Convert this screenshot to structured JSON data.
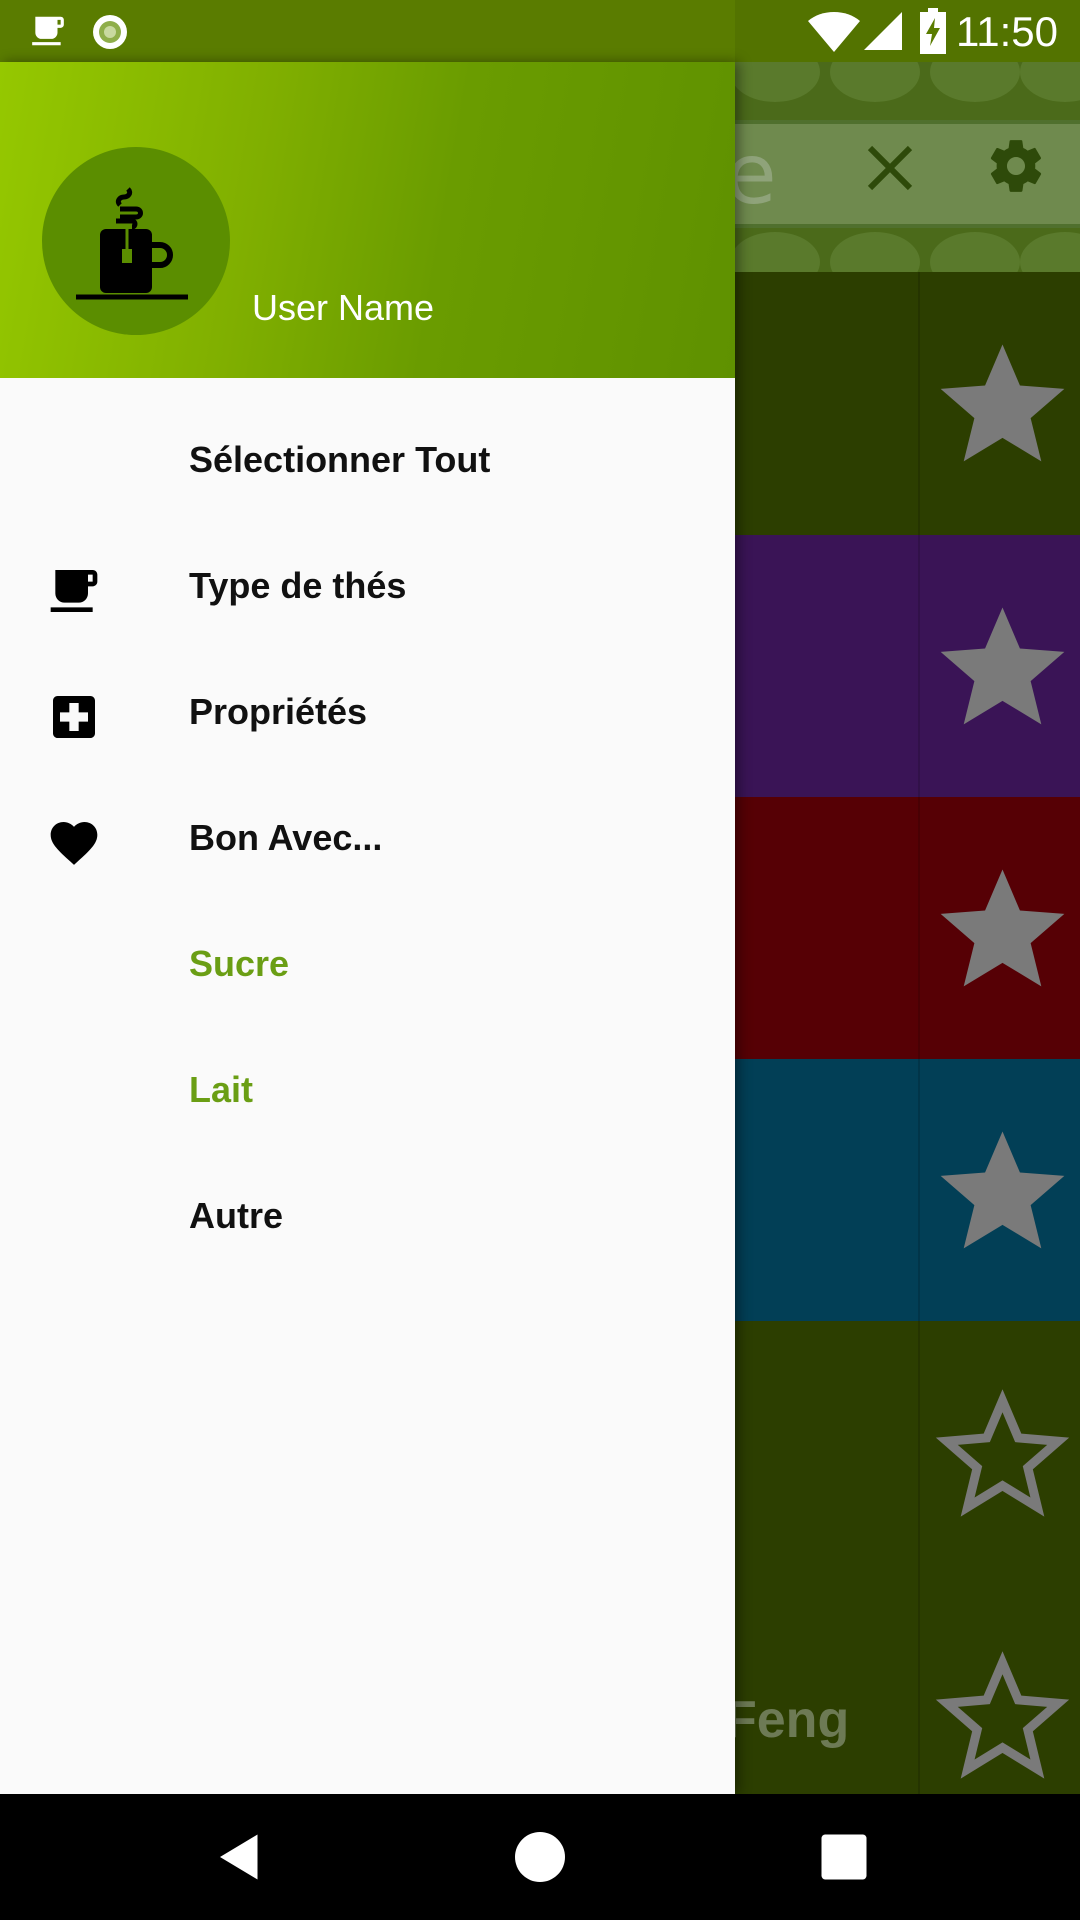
{
  "status_bar": {
    "time": "11:50",
    "icons": [
      "coffee-notification-icon",
      "sync-circle-icon",
      "wifi-icon",
      "signal-icon",
      "battery-charging-icon"
    ]
  },
  "drawer": {
    "header": {
      "user_name": "User Name",
      "avatar_icon": "tea-mug-icon",
      "gradient_start": "#95c800",
      "gradient_end": "#5f9100"
    },
    "items": [
      {
        "label": "Sélectionner Tout",
        "icon": null,
        "color": "#111111"
      },
      {
        "label": "Type de thés",
        "icon": "coffee-cup-icon",
        "color": "#111111"
      },
      {
        "label": "Propriétés",
        "icon": "medical-plus-icon",
        "color": "#111111"
      },
      {
        "label": "Bon Avec...",
        "icon": "heart-icon",
        "color": "#111111"
      },
      {
        "label": "Sucre",
        "icon": null,
        "color": "#6a9e14"
      },
      {
        "label": "Lait",
        "icon": null,
        "color": "#6a9e14"
      },
      {
        "label": "Autre",
        "icon": null,
        "color": "#111111"
      }
    ]
  },
  "background": {
    "search_fragment": "e",
    "last_row_fragment": "Feng",
    "rows": [
      {
        "color": "#2c3e00",
        "favorite": true
      },
      {
        "color": "#3a1456",
        "favorite": true
      },
      {
        "color": "#560005",
        "favorite": true
      },
      {
        "color": "#023f56",
        "favorite": true
      },
      {
        "color": "#2c3e00",
        "favorite": false
      },
      {
        "color": "#2c3e00",
        "favorite": false
      }
    ]
  },
  "nav_bar": {
    "buttons": [
      "back",
      "home",
      "recents"
    ]
  }
}
